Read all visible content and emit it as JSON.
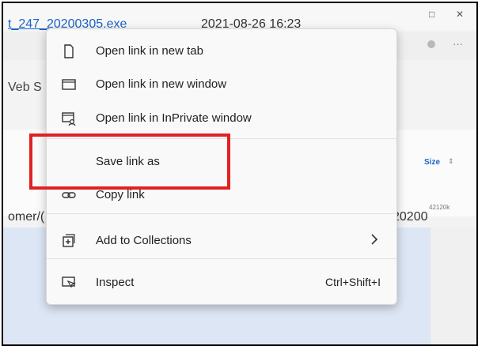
{
  "background": {
    "file_link": "t_247_20200305.exe",
    "date": "2021-08-26 16:23",
    "web_text": "Veb S",
    "path_text": "omer/(",
    "filename_right": "20200",
    "size_header": "Size",
    "size_value": "42120k"
  },
  "window": {
    "minimize_glyph": "□",
    "close_glyph": "✕",
    "more_glyph": "···"
  },
  "context_menu": {
    "items": [
      {
        "label": "Open link in new tab",
        "icon": "new-tab-icon"
      },
      {
        "label": "Open link in new window",
        "icon": "new-window-icon"
      },
      {
        "label": "Open link in InPrivate window",
        "icon": "inprivate-window-icon"
      },
      {
        "label": "Save link as",
        "icon": ""
      },
      {
        "label": "Copy link",
        "icon": "copy-link-icon"
      },
      {
        "label": "Add to Collections",
        "icon": "collections-icon",
        "submenu": true
      },
      {
        "label": "Inspect",
        "icon": "inspect-icon",
        "shortcut": "Ctrl+Shift+I"
      }
    ]
  },
  "colors": {
    "highlight_border": "#e02222",
    "link": "#1a63c9",
    "menu_bg": "#f9f9f9"
  }
}
